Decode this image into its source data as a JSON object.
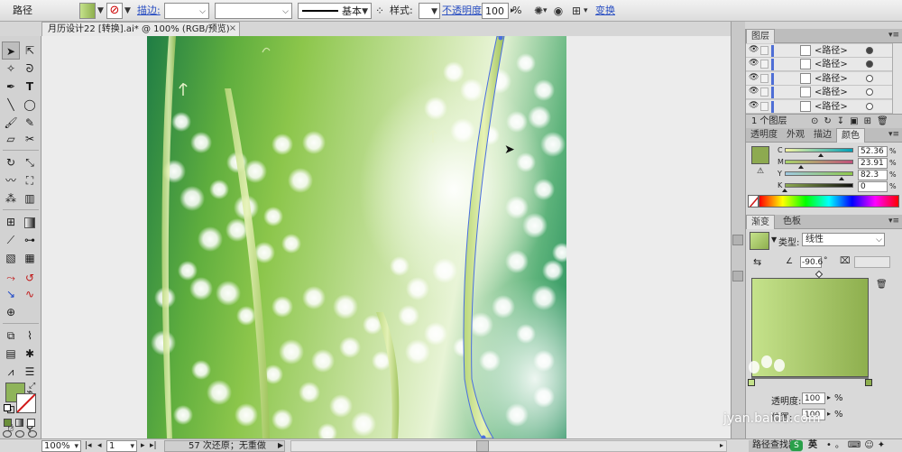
{
  "control_bar": {
    "object_type": "路径",
    "stroke_label": "描边:",
    "stroke_profile": "基本",
    "style_label": "样式:",
    "opacity_label": "不透明度",
    "opacity_value": "100",
    "opacity_unit": "%",
    "transform_label": "变换"
  },
  "document": {
    "tab_title": "月历设计22 [转换].ai* @ 100% (RGB/预览)",
    "close_glyph": "×"
  },
  "tools": {
    "type_tool": "T"
  },
  "layers_panel": {
    "tab": "图层",
    "rows": [
      {
        "name": "<路径>",
        "target_on": true
      },
      {
        "name": "<路径>",
        "target_on": true
      },
      {
        "name": "<路径>",
        "target_on": false
      },
      {
        "name": "<路径>",
        "target_on": false
      },
      {
        "name": "<路径>",
        "target_on": false
      }
    ],
    "footer": "1 个图层"
  },
  "color_panel": {
    "tabs": [
      "透明度",
      "外观",
      "描边",
      "颜色"
    ],
    "active_tab": "颜色",
    "channels": [
      {
        "label": "C",
        "value": "52.36",
        "fraction": 0.5236
      },
      {
        "label": "M",
        "value": "23.91",
        "fraction": 0.2391
      },
      {
        "label": "Y",
        "value": "82.3",
        "fraction": 0.823
      },
      {
        "label": "K",
        "value": "0",
        "fraction": 0
      }
    ],
    "unit": "%",
    "fill_color": "#8daa50"
  },
  "gradient_panel": {
    "tabs": [
      "渐变",
      "色板"
    ],
    "active_tab": "渐变",
    "type_label": "类型:",
    "type_value": "线性",
    "angle_value": "-90.6",
    "angle_unit": "°",
    "stop_start_color": "#c5e28b",
    "stop_end_color": "#8eaf4e",
    "opacity_label_partial": "透明度:",
    "opacity_value": "100",
    "opacity_unit": "%",
    "location_label": "位置:",
    "location_value": "100",
    "location_unit": "%"
  },
  "status_bar": {
    "zoom": "100%",
    "artboard_number": "1",
    "status_text": "57 次还原；无重做",
    "bottom_right_tab": "路径查找器"
  },
  "watermark": {
    "text": "jyan.baidu.com",
    "ime_label": "英"
  },
  "icons": [
    "selection-arrow-icon",
    "direct-selection-icon",
    "magic-wand-icon",
    "lasso-icon",
    "pen-icon",
    "type-icon",
    "line-segment-icon",
    "ellipse-icon",
    "paintbrush-icon",
    "pencil-icon",
    "rotate-icon",
    "scale-icon",
    "warp-icon",
    "free-transform-icon",
    "symbol-sprayer-icon",
    "column-graph-icon",
    "mesh-icon",
    "gradient-icon",
    "eyedropper-icon",
    "blend-icon",
    "live-paint-icon",
    "live-paint-select-icon",
    "crop-area-icon",
    "slice-icon",
    "hand-icon",
    "zoom-icon"
  ]
}
